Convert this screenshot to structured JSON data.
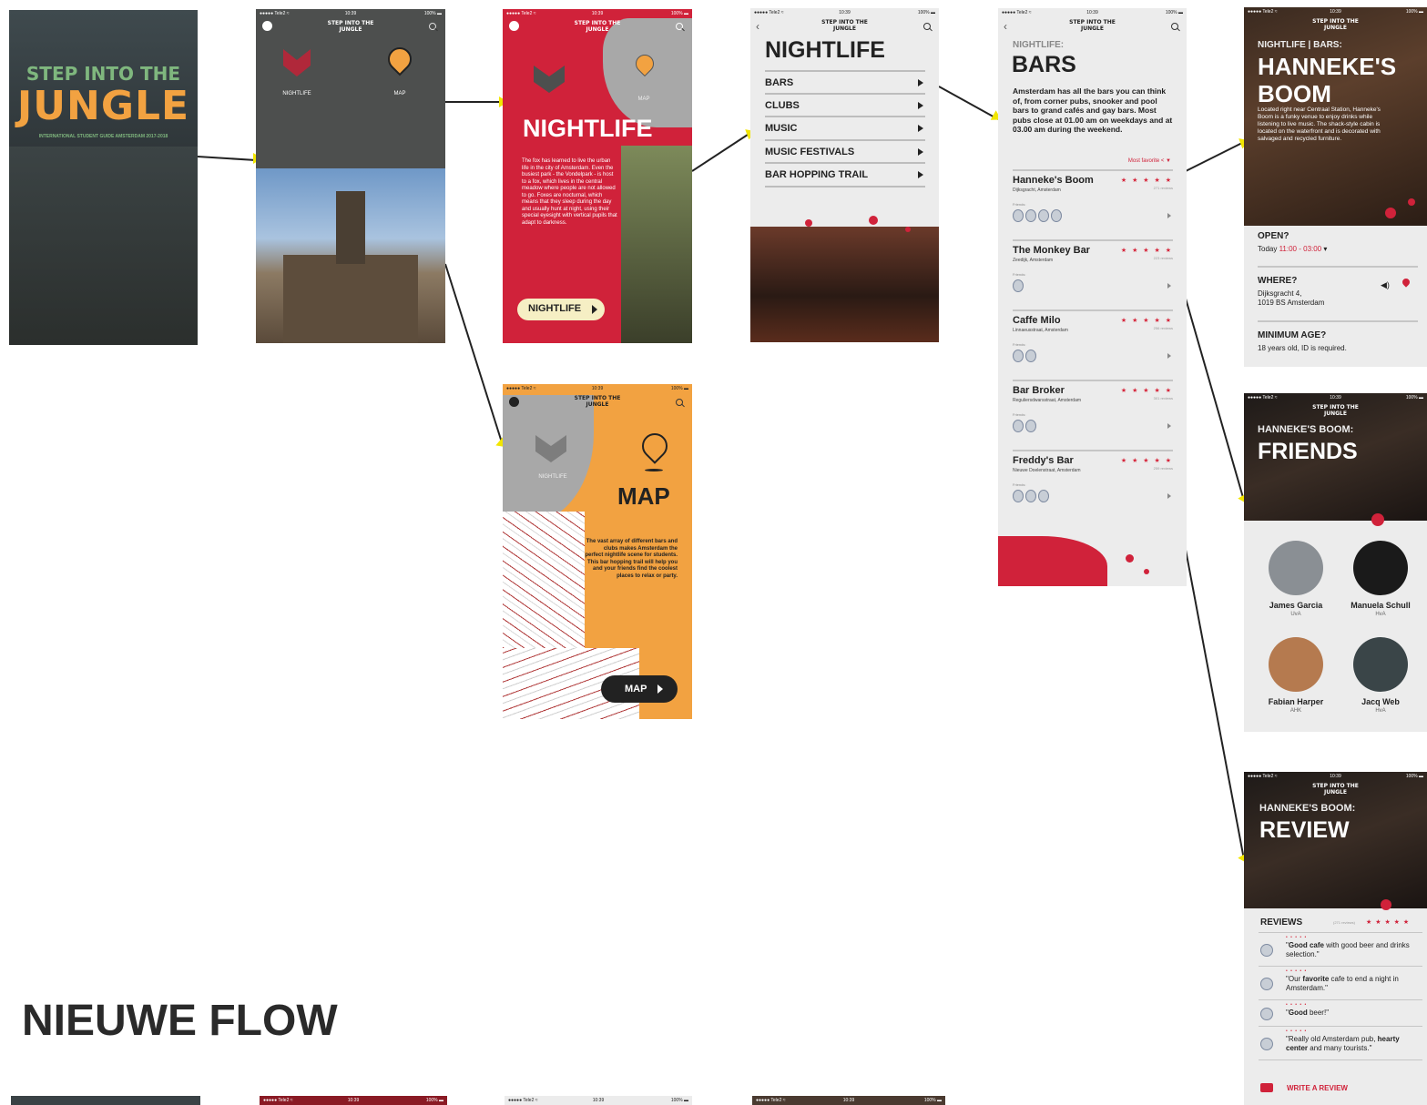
{
  "status": {
    "carrier": "●●●●● Tele2 ≈",
    "time": "10:39",
    "battery": "100% ▬"
  },
  "logo_small": "STEP INTO THE\nJUNGLE",
  "cover": {
    "line1": "STEP INTO THE",
    "line2": "JUNGLE",
    "sub": "INTERNATIONAL STUDENT GUIDE AMSTERDAM 2017-2018"
  },
  "home": {
    "nightlife": "NIGHTLIFE",
    "map": "MAP"
  },
  "nightlife_intro": {
    "small": "MAP",
    "title": "NIGHTLIFE",
    "body": "The fox has learned to live the urban life in the city of Amsterdam. Even the busiest park - the Vondelpark - is host to a fox, which lives in the central meadow where people are not allowed to go. Foxes are nocturnal, which means that they sleep during the day and usually hunt at night, using their special eyesight with vertical pupils that adapt to darkness.",
    "button": "NIGHTLIFE"
  },
  "map_intro": {
    "small": "NIGHTLIFE",
    "title": "MAP",
    "body": "The vast array of different bars and clubs makes Amsterdam the perfect nightlife scene for students. This bar hopping trail will help you and your friends find the coolest places to relax or party.",
    "button": "MAP"
  },
  "nightlife_menu": {
    "title": "NIGHTLIFE",
    "items": [
      "BARS",
      "CLUBS",
      "MUSIC",
      "MUSIC FESTIVALS",
      "BAR HOPPING TRAIL"
    ]
  },
  "bars": {
    "kicker": "NIGHTLIFE:",
    "title": "BARS",
    "intro": "Amsterdam has all the bars you can think of, from corner pubs, snooker and pool bars to grand cafés and gay bars. Most pubs close at 01.00 am on weekdays and at 03.00 am during the weekend.",
    "sort": "Most favorite  <  ▼",
    "friends_label": "Friends:",
    "list": [
      {
        "name": "Hanneke's Boom",
        "addr": "Dijksgracht, Amsterdam",
        "stars": "★ ★ ★ ★ ★",
        "reviews": "271 reviews"
      },
      {
        "name": "The Monkey Bar",
        "addr": "Zeedijk, Amsterdam",
        "stars": "★ ★ ★ ★ ★",
        "reviews": "223 reviews"
      },
      {
        "name": "Caffe Milo",
        "addr": "Linnaeusstraat, Amsterdam",
        "stars": "★ ★ ★ ★ ★",
        "reviews": "256 reviews"
      },
      {
        "name": "Bar Broker",
        "addr": "Reguliersdwarsstraat, Amsterdam",
        "stars": "★ ★ ★ ★ ★",
        "reviews": "301 reviews"
      },
      {
        "name": "Freddy's Bar",
        "addr": "Nieuwe Doelenstraat, Amsterdam",
        "stars": "★ ★ ★ ★ ★",
        "reviews": "259 reviews"
      }
    ]
  },
  "detail": {
    "kicker": "NIGHTLIFE | BARS:",
    "title1": "HANNEKE'S",
    "title2": "BOOM",
    "desc": "Located right near Centraal Station, Hanneke's Boom is a funky venue to enjoy drinks while listening to live music. The shack-style cabin is located on the waterfront and is decorated with salvaged and recycled furniture.",
    "open_label": "OPEN?",
    "open_day": "Today ",
    "open_time": "11:00 - 03:00",
    "where_label": "WHERE?",
    "where_1": "Dijksgracht 4,",
    "where_2": "1019 BS Amsterdam",
    "age_label": "MINIMUM AGE?",
    "age_value": "18 years old, ID is required."
  },
  "friends_screen": {
    "kicker": "HANNEKE'S BOOM:",
    "title": "FRIENDS",
    "people": [
      {
        "name": "James Garcia",
        "school": "UvA"
      },
      {
        "name": "Manuela Schull",
        "school": "HvA"
      },
      {
        "name": "Fabian Harper",
        "school": "AHK"
      },
      {
        "name": "Jacq Web",
        "school": "HvA"
      }
    ]
  },
  "review_screen": {
    "kicker": "HANNEKE'S BOOM:",
    "title": "REVIEW",
    "reviews_label": "REVIEWS",
    "count": "(271 reviews)",
    "stars": "★ ★ ★ ★ ★",
    "items": [
      {
        "pre": "\"",
        "bold": "Good cafe",
        "post": " with good beer and drinks selection.\""
      },
      {
        "pre": "\"Our ",
        "bold": "favorite",
        "post": " cafe to end a night in Amsterdam.\""
      },
      {
        "pre": "\"",
        "bold": "Good",
        "post": " beer!\""
      },
      {
        "pre": "\"Really old Amsterdam pub, ",
        "bold": "hearty center",
        "post": " and many tourists.\""
      }
    ],
    "write": "WRITE A REVIEW"
  },
  "section_title": "NIEUWE FLOW",
  "colors": {
    "red": "#d0223a",
    "orange": "#f2a241",
    "grey": "#4d4f4e",
    "yellow": "#f2e600",
    "cover_green": "#7fb77e"
  }
}
